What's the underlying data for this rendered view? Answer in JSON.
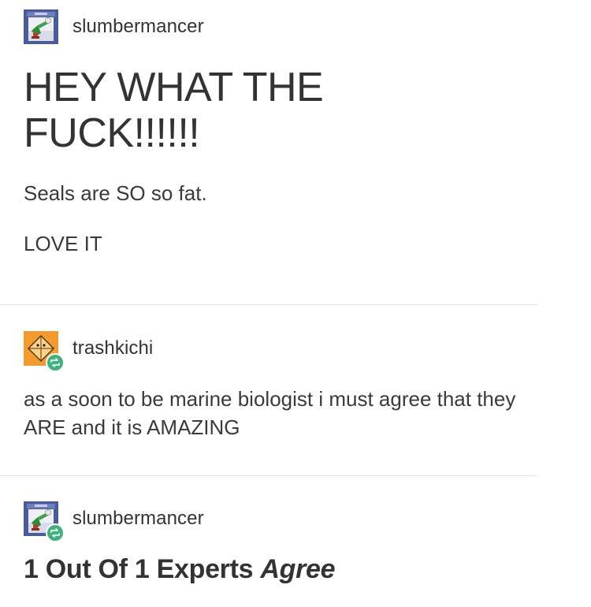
{
  "posts": [
    {
      "username": "slumbermancer",
      "avatar": "slumbermancer-avatar",
      "title": "HEY WHAT THE FUCK!!!!!!",
      "paragraphs": [
        "Seals are SO so fat.",
        "LOVE IT"
      ]
    },
    {
      "username": "trashkichi",
      "avatar": "trashkichi-avatar",
      "reblog_icon": "reblog-icon",
      "paragraphs": [
        "as a soon to be marine biologist i must agree that they ARE and it is AMAZING"
      ]
    },
    {
      "username": "slumbermancer",
      "avatar": "slumbermancer-avatar",
      "reblog_icon": "reblog-icon",
      "text_main": "1 Out Of 1 Experts ",
      "text_emphasis": "Agree"
    }
  ],
  "colors": {
    "text": "#333333",
    "divider": "#e6e6e6",
    "reblog_badge": "#3fb27f",
    "avatar_blue": "#4a5b9a",
    "avatar_orange": "#f29a2e"
  }
}
